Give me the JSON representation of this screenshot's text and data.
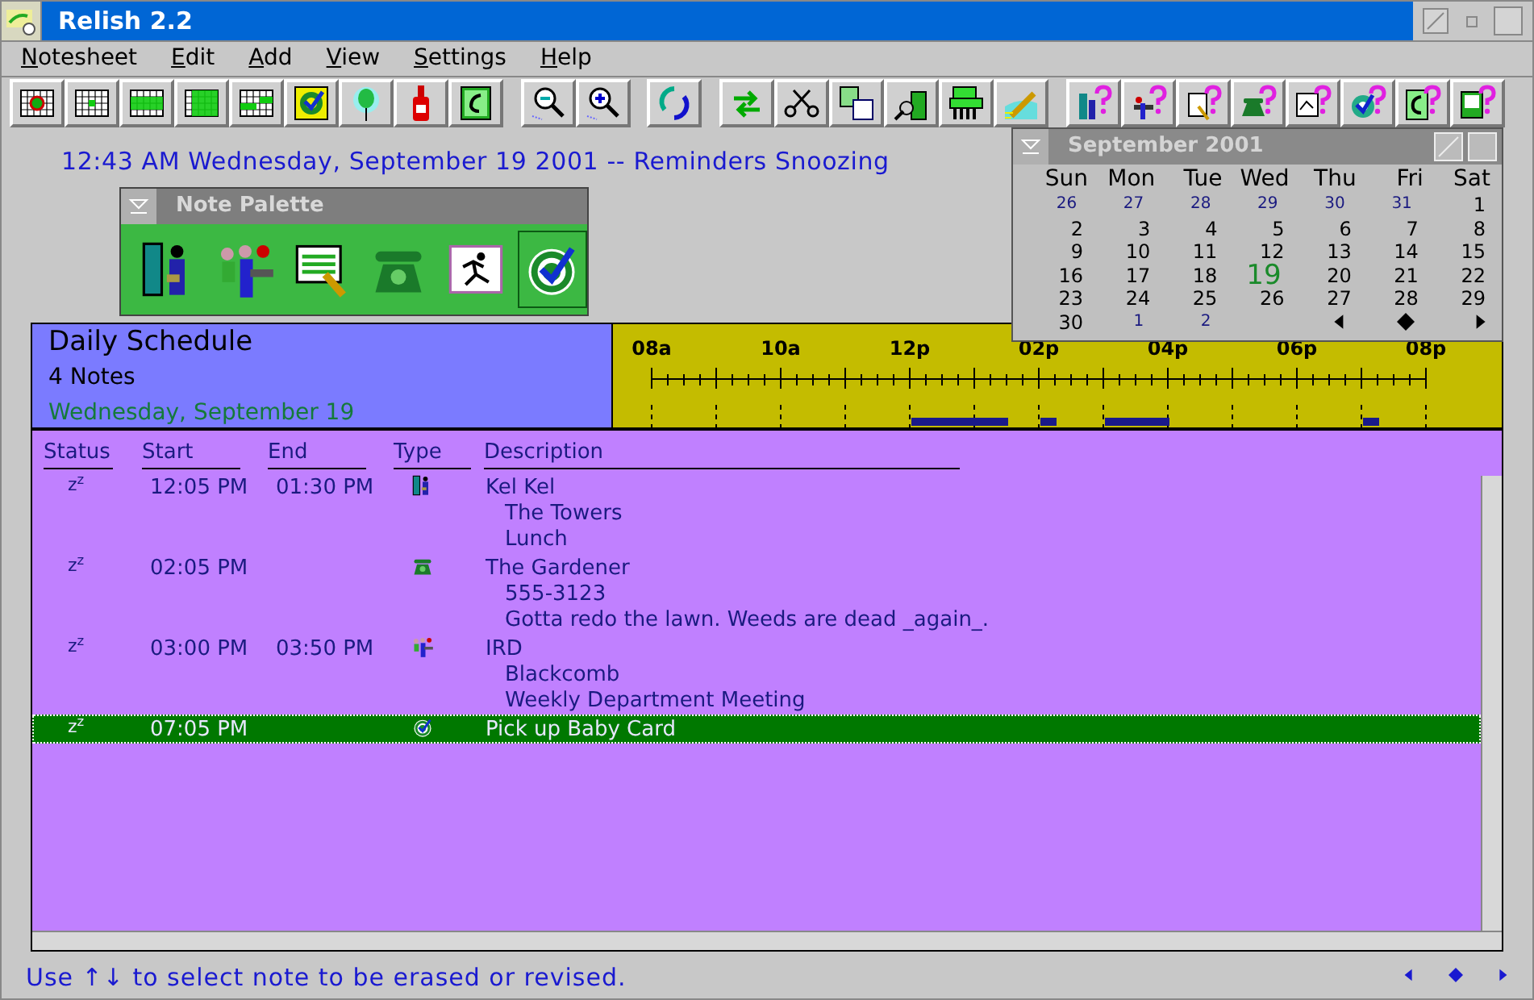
{
  "window": {
    "title": "Relish 2.2"
  },
  "menu": [
    {
      "label": "Notesheet"
    },
    {
      "label": "Edit"
    },
    {
      "label": "Add"
    },
    {
      "label": "View"
    },
    {
      "label": "Settings"
    },
    {
      "label": "Help"
    }
  ],
  "clock_line": "12:43 AM Wednesday, September 19 2001 -- Reminders Snoozing",
  "note_palette": {
    "title": "Note Palette",
    "items": [
      {
        "kind": "visitor",
        "selected": false
      },
      {
        "kind": "meeting",
        "selected": false
      },
      {
        "kind": "notes",
        "selected": false
      },
      {
        "kind": "phone",
        "selected": false
      },
      {
        "kind": "runner",
        "selected": false
      },
      {
        "kind": "target",
        "selected": true
      }
    ]
  },
  "calendar": {
    "title": "September 2001",
    "weekdays": [
      "Sun",
      "Mon",
      "Tue",
      "Wed",
      "Thu",
      "Fri",
      "Sat"
    ],
    "days": [
      {
        "label": "26",
        "kind": "other"
      },
      {
        "label": "27",
        "kind": "other"
      },
      {
        "label": "28",
        "kind": "other"
      },
      {
        "label": "29",
        "kind": "other"
      },
      {
        "label": "30",
        "kind": "other"
      },
      {
        "label": "31",
        "kind": "other"
      },
      {
        "label": "1",
        "kind": "day"
      },
      {
        "label": "2",
        "kind": "day"
      },
      {
        "label": "3",
        "kind": "day"
      },
      {
        "label": "4",
        "kind": "day"
      },
      {
        "label": "5",
        "kind": "day"
      },
      {
        "label": "6",
        "kind": "day"
      },
      {
        "label": "7",
        "kind": "day"
      },
      {
        "label": "8",
        "kind": "day"
      },
      {
        "label": "9",
        "kind": "day"
      },
      {
        "label": "10",
        "kind": "day"
      },
      {
        "label": "11",
        "kind": "day"
      },
      {
        "label": "12",
        "kind": "day"
      },
      {
        "label": "13",
        "kind": "day"
      },
      {
        "label": "14",
        "kind": "day"
      },
      {
        "label": "15",
        "kind": "day"
      },
      {
        "label": "16",
        "kind": "day"
      },
      {
        "label": "17",
        "kind": "day"
      },
      {
        "label": "18",
        "kind": "day"
      },
      {
        "label": "19",
        "kind": "today"
      },
      {
        "label": "20",
        "kind": "day"
      },
      {
        "label": "21",
        "kind": "day"
      },
      {
        "label": "22",
        "kind": "day"
      },
      {
        "label": "23",
        "kind": "day"
      },
      {
        "label": "24",
        "kind": "day"
      },
      {
        "label": "25",
        "kind": "day"
      },
      {
        "label": "26",
        "kind": "day"
      },
      {
        "label": "27",
        "kind": "day"
      },
      {
        "label": "28",
        "kind": "day"
      },
      {
        "label": "29",
        "kind": "day"
      },
      {
        "label": "30",
        "kind": "day"
      },
      {
        "label": "1",
        "kind": "other"
      },
      {
        "label": "2",
        "kind": "other"
      }
    ]
  },
  "schedule": {
    "title": "Daily Schedule",
    "count": "4 Notes",
    "date": "Wednesday, September 19",
    "timeline_labels": [
      "08a",
      "10a",
      "12p",
      "02p",
      "04p",
      "06p",
      "08p"
    ]
  },
  "table": {
    "columns": [
      "Status",
      "Start",
      "End",
      "Type",
      "Description"
    ],
    "rows": [
      {
        "status": "z$^{z}$",
        "start": "12:05 PM",
        "end": "01:30 PM",
        "kind": "visitor",
        "lines": [
          "Kel Kel",
          "The Towers",
          "Lunch"
        ],
        "selected": false
      },
      {
        "status": "z$^{z}$",
        "start": "02:05 PM",
        "kind": "phone",
        "lines": [
          "The Gardener",
          "555-3123",
          "Gotta redo the lawn. Weeds are dead _again_."
        ],
        "selected": false
      },
      {
        "status": "z$^{z}$",
        "start": "03:00 PM",
        "end": "03:50 PM",
        "kind": "meeting",
        "lines": [
          "IRD",
          "Blackcomb",
          "Weekly Department Meeting"
        ],
        "selected": false
      },
      {
        "status": "z$^{z}$",
        "start": "07:05 PM",
        "kind": "target",
        "lines": [
          "Pick up Baby Card"
        ],
        "selected": true
      }
    ]
  },
  "status_bar": "Use ↑↓ to select note to be erased or revised."
}
